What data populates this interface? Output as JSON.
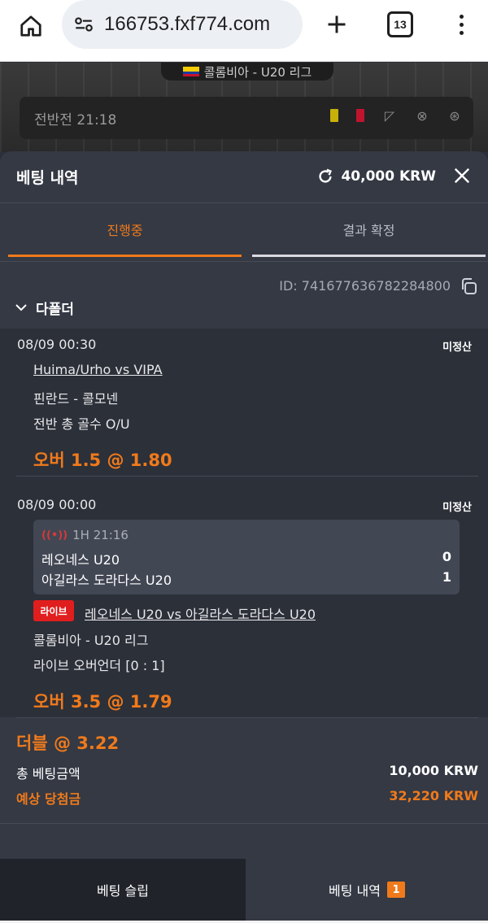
{
  "browser": {
    "url": "166753.fxf774.com",
    "tab_count": "13"
  },
  "background": {
    "league": "콜롬비아 - U20 리그",
    "half_time": "전반전 21:18"
  },
  "sheet": {
    "title": "베팅 내역",
    "balance": "40,000 KRW",
    "tabs": {
      "active": "진행중",
      "inactive": "결과 확정"
    },
    "bet_id": "ID: 741677636782284800",
    "folder_label": "다폴더"
  },
  "legs": [
    {
      "date": "08/09 00:30",
      "status": "미정산",
      "match": "Huima/Urho vs VIPA",
      "league": "핀란드 - 콜모넨",
      "market": "전반 총 골수 O/U",
      "pick": "오버 1.5 @ 1.80"
    },
    {
      "date": "08/09 00:00",
      "status": "미정산",
      "live_clock": "1H 21:16",
      "home_team": "레오네스 U20",
      "home_score": "0",
      "away_team": "아길라스 도라다스 U20",
      "away_score": "1",
      "live_badge": "라이브",
      "match": "레오네스 U20 vs 아길라스 도라다스 U20",
      "league": "콜롬비아 - U20 리그",
      "market": "라이브 오버언더 [0 : 1]",
      "pick": "오버 3.5 @ 1.79"
    }
  ],
  "summary": {
    "title": "더블 @ 3.22",
    "stake_label": "총 베팅금액",
    "stake_value": "10,000 KRW",
    "win_label": "예상 당첨금",
    "win_value": "32,220 KRW"
  },
  "bottom_nav": {
    "slip_label": "베팅 슬립",
    "history_label": "베팅 내역",
    "history_count": "1"
  },
  "colors": {
    "accent": "#f07a1b",
    "live_red": "#e01e1e",
    "sheet_bg": "#343944",
    "panel_bg": "#2c3039"
  },
  "icons": [
    "home-icon",
    "site-settings-icon",
    "plus-icon",
    "tabs-icon",
    "menu-icon",
    "refresh-icon",
    "close-icon",
    "copy-icon",
    "chevron-down-icon",
    "live-stream-icon"
  ]
}
